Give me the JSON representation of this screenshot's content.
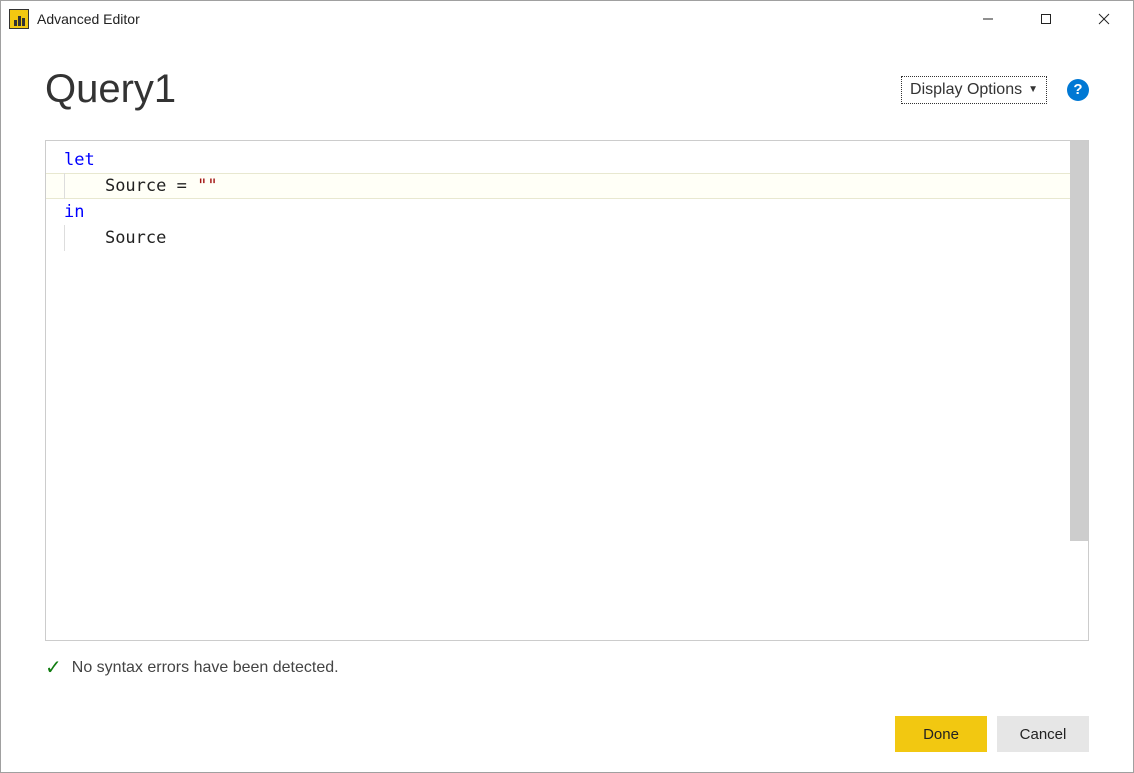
{
  "titlebar": {
    "title": "Advanced Editor"
  },
  "header": {
    "queryName": "Query1",
    "displayOptionsLabel": "Display Options"
  },
  "editor": {
    "code": {
      "line1_keyword": "let",
      "line2_indent": "    ",
      "line2_text": "Source = ",
      "line2_string": "\"\"",
      "line3_keyword": "in",
      "line4_indent": "    ",
      "line4_text": "Source"
    }
  },
  "status": {
    "message": "No syntax errors have been detected."
  },
  "buttons": {
    "done": "Done",
    "cancel": "Cancel"
  }
}
